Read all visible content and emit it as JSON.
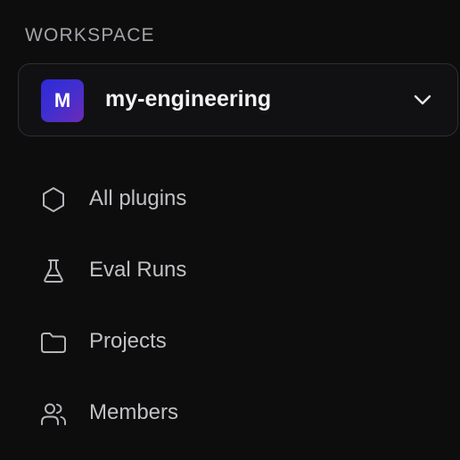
{
  "sidebar": {
    "section_label": "WORKSPACE",
    "workspace": {
      "avatar_letter": "M",
      "name": "my-engineering",
      "avatar_gradient": [
        "#2d2ad8",
        "#6b2bb8"
      ]
    },
    "nav_items": [
      {
        "label": "All plugins",
        "icon": "hexagon-icon"
      },
      {
        "label": "Eval Runs",
        "icon": "flask-icon"
      },
      {
        "label": "Projects",
        "icon": "folder-icon"
      },
      {
        "label": "Members",
        "icon": "users-icon"
      }
    ]
  },
  "colors": {
    "background": "#0d0d0e",
    "text_primary": "#f2f2f3",
    "text_secondary": "#c2c2c6",
    "section_label": "#a3a3a8",
    "border": "#2f2f33"
  }
}
